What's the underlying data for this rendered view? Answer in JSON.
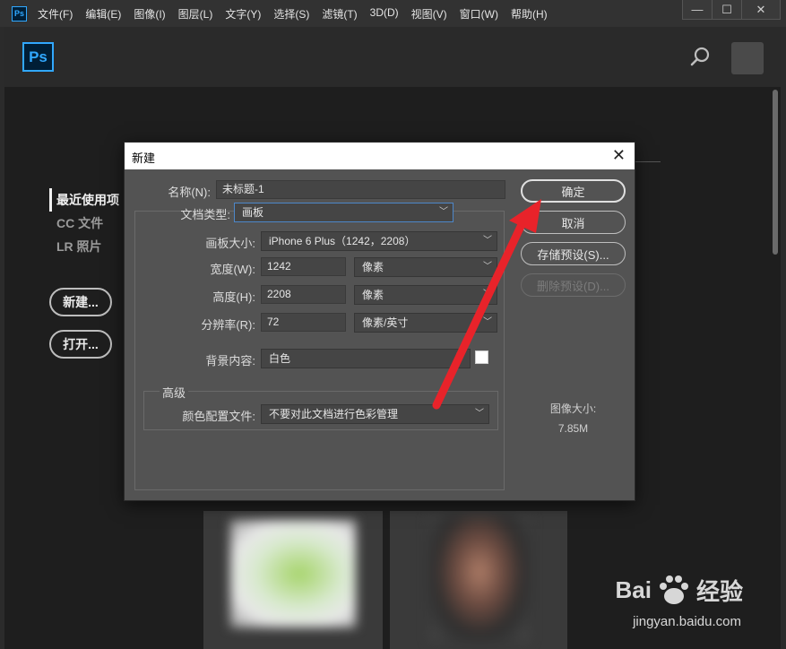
{
  "menubar": {
    "app_icon": "Ps",
    "items": [
      "文件(F)",
      "编辑(E)",
      "图像(I)",
      "图层(L)",
      "文字(Y)",
      "选择(S)",
      "滤镜(T)",
      "3D(D)",
      "视图(V)",
      "窗口(W)",
      "帮助(H)"
    ],
    "window_controls": [
      "—",
      "☐",
      "✕"
    ]
  },
  "workspace": {
    "logo": "Ps",
    "nav": [
      "最近使用项",
      "CC 文件",
      "LR 照片"
    ],
    "new_button": "新建...",
    "open_button": "打开..."
  },
  "dialog": {
    "title": "新建",
    "close": "✕",
    "name_label": "名称(N):",
    "name_value": "未标题-1",
    "doc_type_label": "文档类型:",
    "doc_type_value": "画板",
    "artboard_size_label": "画板大小:",
    "artboard_size_value": "iPhone 6 Plus（1242，2208）",
    "width_label": "宽度(W):",
    "width_value": "1242",
    "width_unit": "像素",
    "height_label": "高度(H):",
    "height_value": "2208",
    "height_unit": "像素",
    "resolution_label": "分辨率(R):",
    "resolution_value": "72",
    "resolution_unit": "像素/英寸",
    "background_label": "背景内容:",
    "background_value": "白色",
    "advanced_title": "高级",
    "color_profile_label": "颜色配置文件:",
    "color_profile_value": "不要对此文档进行色彩管理",
    "ok_button": "确定",
    "cancel_button": "取消",
    "save_preset_button": "存储预设(S)...",
    "delete_preset_button": "删除预设(D)...",
    "image_size_label": "图像大小:",
    "image_size_value": "7.85M"
  },
  "watermark": {
    "brand_left": "Bai",
    "brand_right": "经验",
    "url": "jingyan.baidu.com"
  },
  "colors": {
    "accent": "#31a8ff",
    "annotation_arrow": "#e8232a"
  }
}
